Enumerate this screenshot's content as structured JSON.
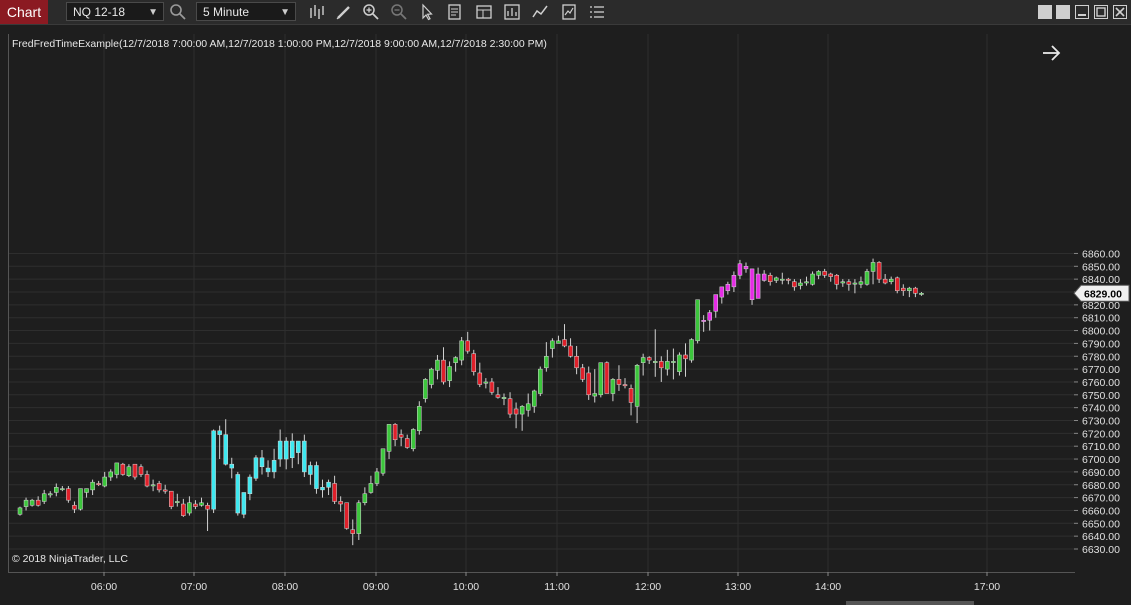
{
  "toolbar": {
    "chart_tab": "Chart",
    "instrument": "NQ 12-18",
    "interval": "5 Minute",
    "icons": [
      "search-icon",
      "bar-type-icon",
      "pencil-icon",
      "zoom-in-icon",
      "zoom-out-icon",
      "pointer-icon",
      "data-box-icon",
      "chart-trader-icon",
      "strategies-icon",
      "indicators-icon",
      "properties-icon",
      "list-icon"
    ]
  },
  "window_controls": [
    "restore-icon",
    "restore-icon",
    "minimize-icon",
    "maximize-icon",
    "close-icon"
  ],
  "indicator_label": "FredFredTimeExample(12/7/2018 7:00:00 AM,12/7/2018 1:00:00 PM,12/7/2018 9:00:00 AM,12/7/2018 2:30:00 PM)",
  "copyright": "© 2018 NinjaTrader, LLC",
  "colors": {
    "background": "#1e1e1e",
    "up": "#3cc63c",
    "down": "#e0202a",
    "cyan": "#3ee8f0",
    "magenta": "#e62be6",
    "grid": "#2e2e2e",
    "price_marker_bg": "#f0f0f0"
  },
  "chart_data": {
    "type": "candlestick",
    "instrument": "NQ 12-18",
    "interval": "5 Minute",
    "ylim": [
      6625,
      6865
    ],
    "y_ticks": [
      6630,
      6640,
      6650,
      6660,
      6670,
      6680,
      6690,
      6700,
      6710,
      6720,
      6730,
      6740,
      6750,
      6760,
      6770,
      6780,
      6790,
      6800,
      6810,
      6820,
      6830,
      6840,
      6850,
      6860
    ],
    "x_ticks": [
      "06:00",
      "07:00",
      "08:00",
      "09:00",
      "10:00",
      "11:00",
      "12:00",
      "13:00",
      "14:00",
      "17:00"
    ],
    "last_price": "6829.00",
    "grid": true,
    "candles": [
      {
        "o": 6657,
        "h": 6663,
        "l": 6656,
        "c": 6662
      },
      {
        "o": 6663,
        "h": 6670,
        "l": 6660,
        "c": 6668
      },
      {
        "o": 6664,
        "h": 6669,
        "l": 6663,
        "c": 6668
      },
      {
        "o": 6668,
        "h": 6671,
        "l": 6663,
        "c": 6664
      },
      {
        "o": 6667,
        "h": 6676,
        "l": 6665,
        "c": 6673
      },
      {
        "o": 6673,
        "h": 6675,
        "l": 6670,
        "c": 6673
      },
      {
        "o": 6674,
        "h": 6681,
        "l": 6671,
        "c": 6678
      },
      {
        "o": 6677,
        "h": 6679,
        "l": 6675,
        "c": 6677
      },
      {
        "o": 6677,
        "h": 6679,
        "l": 6666,
        "c": 6668
      },
      {
        "o": 6664,
        "h": 6667,
        "l": 6658,
        "c": 6661
      },
      {
        "o": 6661,
        "h": 6677,
        "l": 6660,
        "c": 6677
      },
      {
        "o": 6674,
        "h": 6677,
        "l": 6670,
        "c": 6677
      },
      {
        "o": 6676,
        "h": 6684,
        "l": 6672,
        "c": 6682
      },
      {
        "o": 6681,
        "h": 6683,
        "l": 6679,
        "c": 6680
      },
      {
        "o": 6679,
        "h": 6690,
        "l": 6678,
        "c": 6686
      },
      {
        "o": 6686,
        "h": 6692,
        "l": 6683,
        "c": 6690
      },
      {
        "o": 6688,
        "h": 6697,
        "l": 6685,
        "c": 6697
      },
      {
        "o": 6696,
        "h": 6697,
        "l": 6687,
        "c": 6688
      },
      {
        "o": 6687,
        "h": 6696,
        "l": 6686,
        "c": 6694
      },
      {
        "o": 6696,
        "h": 6696,
        "l": 6684,
        "c": 6686
      },
      {
        "o": 6694,
        "h": 6696,
        "l": 6686,
        "c": 6688
      },
      {
        "o": 6688,
        "h": 6691,
        "l": 6678,
        "c": 6679
      },
      {
        "o": 6680,
        "h": 6684,
        "l": 6675,
        "c": 6680
      },
      {
        "o": 6681,
        "h": 6683,
        "l": 6674,
        "c": 6676
      },
      {
        "o": 6676,
        "h": 6680,
        "l": 6673,
        "c": 6675
      },
      {
        "o": 6675,
        "h": 6675,
        "l": 6661,
        "c": 6663
      },
      {
        "o": 6667,
        "h": 6673,
        "l": 6663,
        "c": 6667
      },
      {
        "o": 6665,
        "h": 6669,
        "l": 6655,
        "c": 6656
      },
      {
        "o": 6658,
        "h": 6671,
        "l": 6656,
        "c": 6666
      },
      {
        "o": 6665,
        "h": 6668,
        "l": 6661,
        "c": 6663
      },
      {
        "o": 6664,
        "h": 6670,
        "l": 6663,
        "c": 6666
      },
      {
        "o": 6664,
        "h": 6666,
        "l": 6644,
        "c": 6661
      },
      {
        "o": 6661,
        "h": 6723,
        "l": 6658,
        "c": 6722
      },
      {
        "o": 6722,
        "h": 6726,
        "l": 6700,
        "c": 6719
      },
      {
        "o": 6719,
        "h": 6731,
        "l": 6695,
        "c": 6696
      },
      {
        "o": 6696,
        "h": 6701,
        "l": 6685,
        "c": 6693
      },
      {
        "o": 6688,
        "h": 6690,
        "l": 6656,
        "c": 6658
      },
      {
        "o": 6657,
        "h": 6667,
        "l": 6654,
        "c": 6674
      },
      {
        "o": 6673,
        "h": 6688,
        "l": 6668,
        "c": 6686
      },
      {
        "o": 6685,
        "h": 6703,
        "l": 6683,
        "c": 6701
      },
      {
        "o": 6701,
        "h": 6707,
        "l": 6688,
        "c": 6694
      },
      {
        "o": 6693,
        "h": 6699,
        "l": 6686,
        "c": 6690
      },
      {
        "o": 6690,
        "h": 6708,
        "l": 6685,
        "c": 6699
      },
      {
        "o": 6700,
        "h": 6723,
        "l": 6694,
        "c": 6714
      },
      {
        "o": 6714,
        "h": 6717,
        "l": 6692,
        "c": 6700
      },
      {
        "o": 6701,
        "h": 6720,
        "l": 6693,
        "c": 6714
      },
      {
        "o": 6705,
        "h": 6714,
        "l": 6696,
        "c": 6714
      },
      {
        "o": 6714,
        "h": 6719,
        "l": 6686,
        "c": 6690
      },
      {
        "o": 6688,
        "h": 6698,
        "l": 6680,
        "c": 6695
      },
      {
        "o": 6695,
        "h": 6698,
        "l": 6673,
        "c": 6677
      },
      {
        "o": 6678,
        "h": 6684,
        "l": 6670,
        "c": 6676
      },
      {
        "o": 6678,
        "h": 6684,
        "l": 6672,
        "c": 6682
      },
      {
        "o": 6681,
        "h": 6687,
        "l": 6665,
        "c": 6667
      },
      {
        "o": 6667,
        "h": 6671,
        "l": 6659,
        "c": 6665
      },
      {
        "o": 6666,
        "h": 6666,
        "l": 6645,
        "c": 6646
      },
      {
        "o": 6645,
        "h": 6653,
        "l": 6633,
        "c": 6642
      },
      {
        "o": 6642,
        "h": 6668,
        "l": 6637,
        "c": 6666
      },
      {
        "o": 6666,
        "h": 6678,
        "l": 6664,
        "c": 6673
      },
      {
        "o": 6674,
        "h": 6687,
        "l": 6673,
        "c": 6681
      },
      {
        "o": 6681,
        "h": 6693,
        "l": 6679,
        "c": 6690
      },
      {
        "o": 6689,
        "h": 6707,
        "l": 6687,
        "c": 6708
      },
      {
        "o": 6706,
        "h": 6725,
        "l": 6700,
        "c": 6727
      },
      {
        "o": 6727,
        "h": 6728,
        "l": 6710,
        "c": 6715
      },
      {
        "o": 6719,
        "h": 6723,
        "l": 6710,
        "c": 6717
      },
      {
        "o": 6716,
        "h": 6719,
        "l": 6708,
        "c": 6709
      },
      {
        "o": 6708,
        "h": 6724,
        "l": 6706,
        "c": 6723
      },
      {
        "o": 6722,
        "h": 6745,
        "l": 6719,
        "c": 6741
      },
      {
        "o": 6747,
        "h": 6763,
        "l": 6744,
        "c": 6762
      },
      {
        "o": 6758,
        "h": 6771,
        "l": 6755,
        "c": 6770
      },
      {
        "o": 6769,
        "h": 6781,
        "l": 6762,
        "c": 6777
      },
      {
        "o": 6777,
        "h": 6787,
        "l": 6758,
        "c": 6760
      },
      {
        "o": 6761,
        "h": 6776,
        "l": 6756,
        "c": 6772
      },
      {
        "o": 6775,
        "h": 6780,
        "l": 6768,
        "c": 6779
      },
      {
        "o": 6777,
        "h": 6795,
        "l": 6773,
        "c": 6792
      },
      {
        "o": 6792,
        "h": 6799,
        "l": 6782,
        "c": 6784
      },
      {
        "o": 6782,
        "h": 6785,
        "l": 6765,
        "c": 6768
      },
      {
        "o": 6767,
        "h": 6775,
        "l": 6756,
        "c": 6758
      },
      {
        "o": 6759,
        "h": 6763,
        "l": 6755,
        "c": 6760
      },
      {
        "o": 6760,
        "h": 6763,
        "l": 6750,
        "c": 6752
      },
      {
        "o": 6750,
        "h": 6756,
        "l": 6747,
        "c": 6748
      },
      {
        "o": 6747,
        "h": 6751,
        "l": 6742,
        "c": 6748
      },
      {
        "o": 6747,
        "h": 6752,
        "l": 6732,
        "c": 6735
      },
      {
        "o": 6739,
        "h": 6744,
        "l": 6724,
        "c": 6735
      },
      {
        "o": 6735,
        "h": 6742,
        "l": 6722,
        "c": 6741
      },
      {
        "o": 6738,
        "h": 6751,
        "l": 6733,
        "c": 6743
      },
      {
        "o": 6741,
        "h": 6754,
        "l": 6736,
        "c": 6753
      },
      {
        "o": 6751,
        "h": 6772,
        "l": 6749,
        "c": 6770
      },
      {
        "o": 6771,
        "h": 6791,
        "l": 6768,
        "c": 6780
      },
      {
        "o": 6786,
        "h": 6794,
        "l": 6779,
        "c": 6792
      },
      {
        "o": 6790,
        "h": 6796,
        "l": 6790,
        "c": 6792
      },
      {
        "o": 6793,
        "h": 6805,
        "l": 6787,
        "c": 6788
      },
      {
        "o": 6788,
        "h": 6794,
        "l": 6779,
        "c": 6780
      },
      {
        "o": 6780,
        "h": 6788,
        "l": 6766,
        "c": 6771
      },
      {
        "o": 6771,
        "h": 6774,
        "l": 6760,
        "c": 6762
      },
      {
        "o": 6767,
        "h": 6772,
        "l": 6746,
        "c": 6750
      },
      {
        "o": 6749,
        "h": 6770,
        "l": 6744,
        "c": 6751
      },
      {
        "o": 6750,
        "h": 6775,
        "l": 6748,
        "c": 6775
      },
      {
        "o": 6775,
        "h": 6776,
        "l": 6751,
        "c": 6751
      },
      {
        "o": 6751,
        "h": 6763,
        "l": 6745,
        "c": 6762
      },
      {
        "o": 6762,
        "h": 6773,
        "l": 6753,
        "c": 6758
      },
      {
        "o": 6758,
        "h": 6763,
        "l": 6755,
        "c": 6757
      },
      {
        "o": 6755,
        "h": 6758,
        "l": 6734,
        "c": 6744
      },
      {
        "o": 6741,
        "h": 6774,
        "l": 6728,
        "c": 6773
      },
      {
        "o": 6775,
        "h": 6782,
        "l": 6765,
        "c": 6779
      },
      {
        "o": 6779,
        "h": 6780,
        "l": 6774,
        "c": 6777
      },
      {
        "o": 6776,
        "h": 6801,
        "l": 6764,
        "c": 6776
      },
      {
        "o": 6776,
        "h": 6780,
        "l": 6760,
        "c": 6771
      },
      {
        "o": 6770,
        "h": 6785,
        "l": 6765,
        "c": 6776
      },
      {
        "o": 6776,
        "h": 6786,
        "l": 6762,
        "c": 6776
      },
      {
        "o": 6768,
        "h": 6783,
        "l": 6765,
        "c": 6781
      },
      {
        "o": 6781,
        "h": 6790,
        "l": 6764,
        "c": 6778
      },
      {
        "o": 6777,
        "h": 6794,
        "l": 6775,
        "c": 6793
      },
      {
        "o": 6792,
        "h": 6806,
        "l": 6790,
        "c": 6824
      },
      {
        "o": 6807,
        "h": 6812,
        "l": 6799,
        "c": 6808
      },
      {
        "o": 6808,
        "h": 6816,
        "l": 6800,
        "c": 6814
      },
      {
        "o": 6815,
        "h": 6823,
        "l": 6810,
        "c": 6828
      },
      {
        "o": 6826,
        "h": 6834,
        "l": 6821,
        "c": 6834
      },
      {
        "o": 6831,
        "h": 6838,
        "l": 6828,
        "c": 6836
      },
      {
        "o": 6834,
        "h": 6846,
        "l": 6830,
        "c": 6843
      },
      {
        "o": 6843,
        "h": 6855,
        "l": 6840,
        "c": 6852
      },
      {
        "o": 6850,
        "h": 6853,
        "l": 6845,
        "c": 6848
      },
      {
        "o": 6848,
        "h": 6848,
        "l": 6820,
        "c": 6824
      },
      {
        "o": 6825,
        "h": 6849,
        "l": 6826,
        "c": 6844
      },
      {
        "o": 6844,
        "h": 6847,
        "l": 6838,
        "c": 6839
      },
      {
        "o": 6843,
        "h": 6845,
        "l": 6835,
        "c": 6838
      },
      {
        "o": 6839,
        "h": 6842,
        "l": 6837,
        "c": 6841
      },
      {
        "o": 6840,
        "h": 6845,
        "l": 6836,
        "c": 6840
      },
      {
        "o": 6840,
        "h": 6841,
        "l": 6836,
        "c": 6839
      },
      {
        "o": 6838,
        "h": 6840,
        "l": 6831,
        "c": 6834
      },
      {
        "o": 6835,
        "h": 6840,
        "l": 6832,
        "c": 6837
      },
      {
        "o": 6837,
        "h": 6842,
        "l": 6835,
        "c": 6838
      },
      {
        "o": 6836,
        "h": 6846,
        "l": 6835,
        "c": 6844
      },
      {
        "o": 6843,
        "h": 6847,
        "l": 6840,
        "c": 6846
      },
      {
        "o": 6846,
        "h": 6848,
        "l": 6841,
        "c": 6843
      },
      {
        "o": 6844,
        "h": 6845,
        "l": 6838,
        "c": 6842
      },
      {
        "o": 6843,
        "h": 6844,
        "l": 6832,
        "c": 6836
      },
      {
        "o": 6837,
        "h": 6840,
        "l": 6834,
        "c": 6838
      },
      {
        "o": 6838,
        "h": 6840,
        "l": 6831,
        "c": 6836
      },
      {
        "o": 6837,
        "h": 6840,
        "l": 6829,
        "c": 6837
      },
      {
        "o": 6836,
        "h": 6842,
        "l": 6833,
        "c": 6838
      },
      {
        "o": 6836,
        "h": 6848,
        "l": 6835,
        "c": 6846
      },
      {
        "o": 6846,
        "h": 6856,
        "l": 6836,
        "c": 6853
      },
      {
        "o": 6853,
        "h": 6854,
        "l": 6837,
        "c": 6840
      },
      {
        "o": 6840,
        "h": 6844,
        "l": 6836,
        "c": 6837
      },
      {
        "o": 6838,
        "h": 6842,
        "l": 6836,
        "c": 6840
      },
      {
        "o": 6841,
        "h": 6842,
        "l": 6829,
        "c": 6831
      },
      {
        "o": 6833,
        "h": 6836,
        "l": 6827,
        "c": 6831
      },
      {
        "o": 6831,
        "h": 6834,
        "l": 6826,
        "c": 6833
      },
      {
        "o": 6833,
        "h": 6834,
        "l": 6826,
        "c": 6829
      },
      {
        "o": 6829,
        "h": 6830,
        "l": 6827,
        "c": 6829
      }
    ]
  }
}
